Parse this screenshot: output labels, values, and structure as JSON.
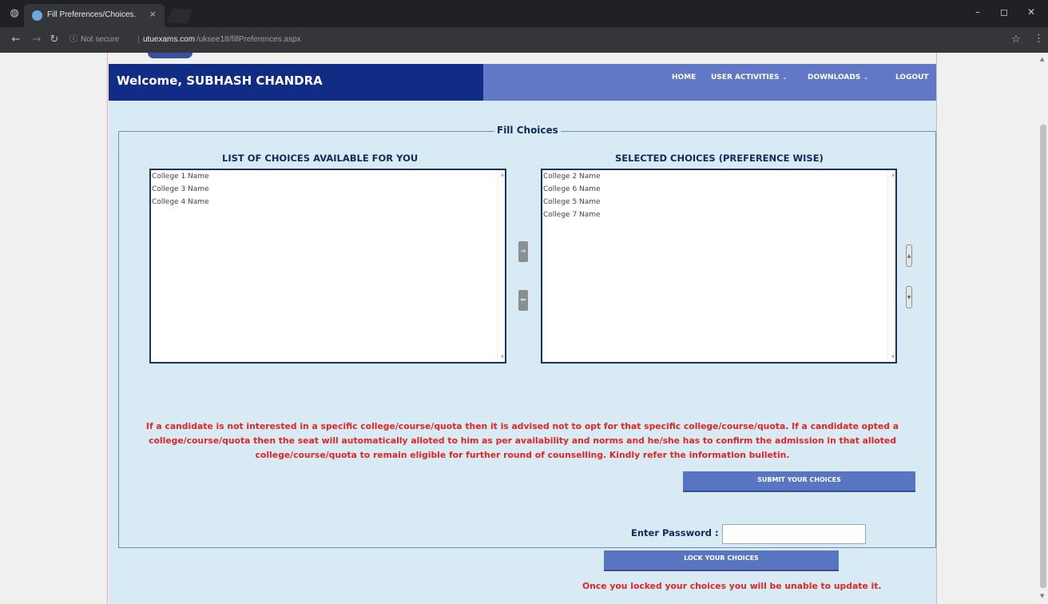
{
  "browser": {
    "tab_title": "Fill Preferences/Choices.",
    "tab_close": "×",
    "security_label": "Not secure",
    "url_domain": "utuexams.com",
    "url_path": "/uksee18/fillPreferences.aspx",
    "window_controls": [
      "–",
      "◻",
      "✕"
    ]
  },
  "header": {
    "welcome": "Welcome, SUBHASH CHANDRA",
    "nav": [
      "HOME",
      "USER ACTIVITIES",
      "DOWNLOADS",
      "LOGOUT"
    ]
  },
  "form": {
    "legend": "Fill Choices",
    "available_heading": "LIST OF CHOICES AVAILABLE FOR YOU",
    "selected_heading": "SELECTED CHOICES (PREFERENCE WISE)",
    "available_options": [
      "College 1 Name",
      "College 3 Name",
      "College 4 Name"
    ],
    "selected_options": [
      "College 2 Name",
      "College 6 Name",
      "College 5 Name",
      "College 7 Name"
    ],
    "notice": "If a candidate is not interested in a specific college/course/quota then it is advised not to opt for that specific college/course/quota. If a candidate opted a college/course/quota then the seat will automatically alloted to him as per availability and norms and he/she has to confirm the admission in that alloted college/course/quota to remain eligible for further round of counselling. Kindly refer the information bulletin.",
    "submit_label": "SUBMIT YOUR CHOICES",
    "password_label": "Enter Password :",
    "password_value": "",
    "lock_label": "LOCK YOUR CHOICES",
    "lock_note": "Once you locked your choices you will be unable to update it."
  },
  "colors": {
    "header_bg": "#102c84",
    "nav_bg": "#6078c6",
    "content_bg": "#d8eaf3",
    "warning_text": "#e22525",
    "button_bg": "#5875c2"
  },
  "icons": {
    "move_right": "arrow-right-icon",
    "move_left": "arrow-left-icon",
    "move_up": "move-up-icon",
    "move_down": "move-down-icon"
  }
}
